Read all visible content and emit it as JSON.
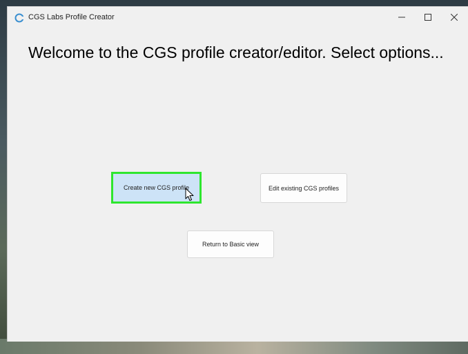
{
  "window": {
    "title": "CGS Labs Profile Creator",
    "icon": "cgs-logo-icon",
    "controls": {
      "minimize_icon": "minimize-icon",
      "maximize_icon": "maximize-icon",
      "close_icon": "close-icon"
    }
  },
  "main": {
    "heading": "Welcome to the CGS profile creator/editor. Select options...",
    "buttons": {
      "create_label": "Create new CGS profile",
      "edit_label": "Edit existing CGS profiles",
      "return_label": "Return to Basic view"
    },
    "focused_button": "Create new CGS profile"
  },
  "colors": {
    "window_bg": "#f0f0f0",
    "focus_highlight": "#2ee62e",
    "selected_button_bg": "#cde3f7"
  }
}
